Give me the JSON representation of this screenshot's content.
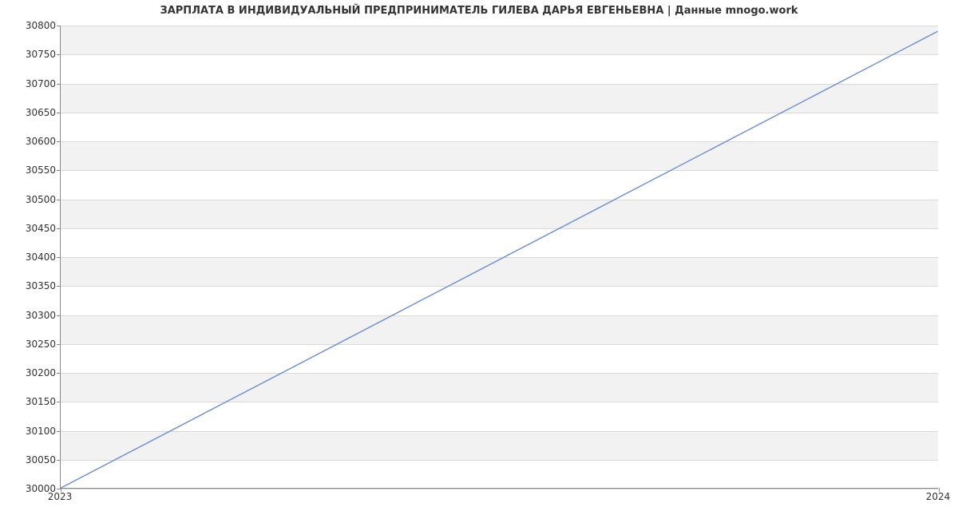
{
  "chart_data": {
    "type": "line",
    "title": "ЗАРПЛАТА В ИНДИВИДУАЛЬНЫЙ ПРЕДПРИНИМАТЕЛЬ ГИЛЕВА ДАРЬЯ ЕВГЕНЬЕВНА | Данные mnogo.work",
    "xlabel": "",
    "ylabel": "",
    "x": [
      2023,
      2024
    ],
    "series": [
      {
        "name": "salary",
        "values": [
          30000,
          30790
        ],
        "color": "#6b8fd4"
      }
    ],
    "x_ticks": [
      2023,
      2024
    ],
    "y_ticks": [
      30000,
      30050,
      30100,
      30150,
      30200,
      30250,
      30300,
      30350,
      30400,
      30450,
      30500,
      30550,
      30600,
      30650,
      30700,
      30750,
      30800
    ],
    "ylim": [
      30000,
      30800
    ],
    "xlim": [
      2023,
      2024
    ],
    "grid": true
  }
}
